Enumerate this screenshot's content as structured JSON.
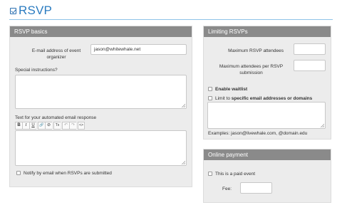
{
  "header": {
    "title": "RSVP"
  },
  "basics": {
    "heading": "RSVP basics",
    "organizer_label": "E-mail address of event organizer",
    "organizer_value": "jason@whitewhale.net",
    "instructions_label": "Special instructions?",
    "instructions_value": "",
    "email_response_label": "Text for your automated email response",
    "toolbar": {
      "bold": "B",
      "italic": "I",
      "underline": "U",
      "link": "🔗",
      "unlink": "⊘",
      "clear_format": "Tx",
      "undo": "↶",
      "redo": "↷",
      "source": "<>"
    },
    "notify_label": "Notify by email when RSVPs are submitted"
  },
  "limits": {
    "heading": "Limiting RSVPs",
    "max_attendees_label": "Maximum RSVP attendees",
    "max_attendees_value": "",
    "max_per_rsvp_label": "Maximum attendees per RSVP submission",
    "max_per_rsvp_value": "",
    "waitlist_label": "Enable waitlist",
    "limit_prefix": "Limit to ",
    "limit_bold": "specific email addresses or domains",
    "examples_text": "Examples: jason@livewhale.com, @domain.edu"
  },
  "payment": {
    "heading": "Online payment",
    "paid_label": "This is a paid event",
    "fee_label": "Fee:",
    "fee_value": ""
  }
}
